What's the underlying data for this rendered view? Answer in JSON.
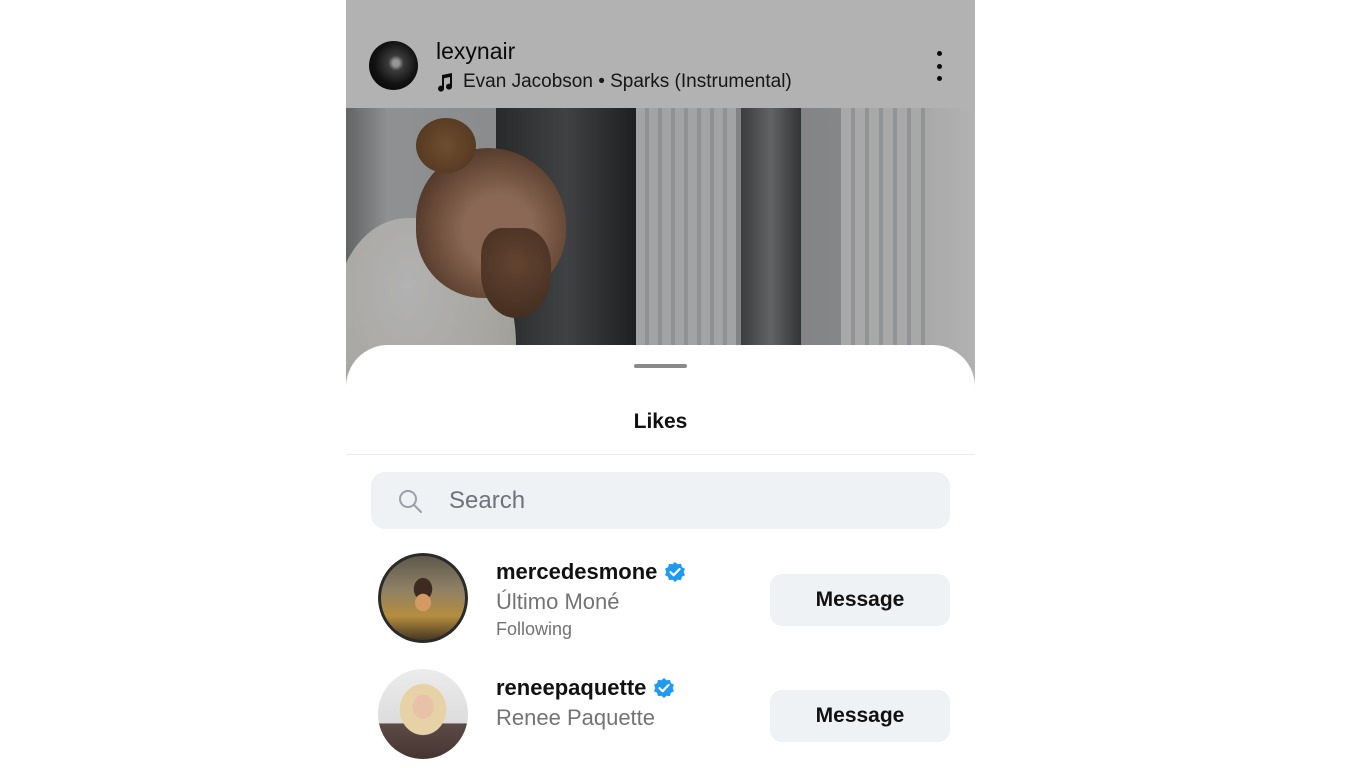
{
  "post": {
    "username": "lexynair",
    "music": "Evan Jacobson • Sparks (Instrumental)",
    "icons": {
      "music": "music-note-icon",
      "more": "more-options-icon"
    }
  },
  "sheet": {
    "title": "Likes",
    "search": {
      "placeholder": "Search",
      "value": ""
    },
    "users": [
      {
        "username": "mercedesmone",
        "full_name": "Último Moné",
        "status": "Following",
        "verified": true,
        "action_label": "Message"
      },
      {
        "username": "reneepaquette",
        "full_name": "Renee Paquette",
        "status": "",
        "verified": true,
        "action_label": "Message"
      }
    ]
  },
  "colors": {
    "verified_blue": "#1d9bf0",
    "button_bg": "#eff2f5",
    "secondary_text": "#737373"
  }
}
